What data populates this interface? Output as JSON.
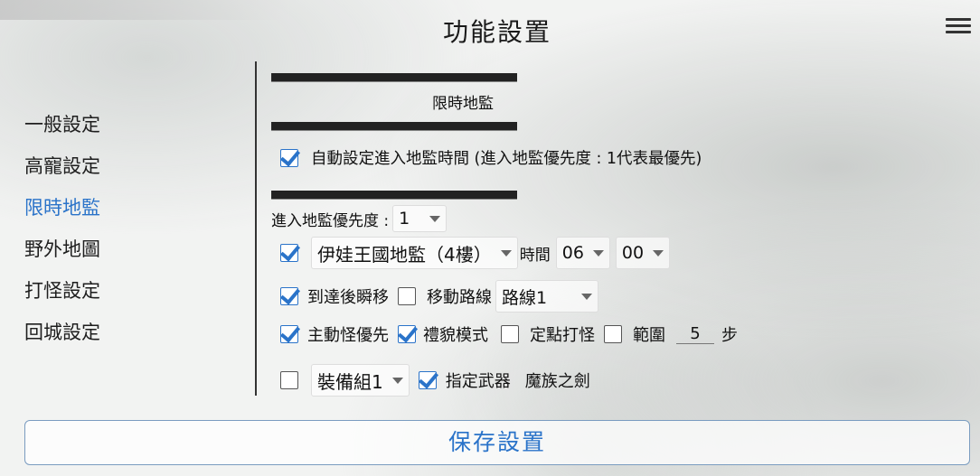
{
  "header": {
    "title": "功能設置"
  },
  "sidebar": {
    "items": [
      {
        "label": "一般設定",
        "active": false
      },
      {
        "label": "高寵設定",
        "active": false
      },
      {
        "label": "限時地監",
        "active": true
      },
      {
        "label": "野外地圖",
        "active": false
      },
      {
        "label": "打怪設定",
        "active": false
      },
      {
        "label": "回城設定",
        "active": false
      }
    ]
  },
  "main": {
    "divider_text": "■■■■■■■■■■■■■■■■■■■■■■■■■■■■■■■■■",
    "section_title": "限時地監",
    "auto_time": {
      "checked": true,
      "label": "自動設定進入地監時間 (進入地監優先度 : 1代表最優先)"
    },
    "priority": {
      "label": "進入地監優先度 :",
      "value": "1"
    },
    "dungeon": {
      "checked": true,
      "value": "伊娃王國地監（4樓）",
      "time_label": "時間",
      "hour": "06",
      "minute": "00"
    },
    "teleport": {
      "checked": true,
      "label": "到達後瞬移"
    },
    "route": {
      "checked": false,
      "label": "移動路線",
      "value": "路線1"
    },
    "aggressive": {
      "checked": true,
      "label": "主動怪優先"
    },
    "polite": {
      "checked": true,
      "label": "禮貌模式"
    },
    "fixed": {
      "checked": false,
      "label": "定點打怪"
    },
    "range": {
      "checked": false,
      "label": "範圍",
      "value": "5",
      "unit": "步"
    },
    "equip": {
      "checked": false,
      "value": "裝備組1"
    },
    "weapon": {
      "checked": true,
      "label": "指定武器",
      "value": "魔族之劍"
    }
  },
  "footer": {
    "save_label": "保存設置"
  },
  "colors": {
    "accent": "#2a73c9"
  }
}
